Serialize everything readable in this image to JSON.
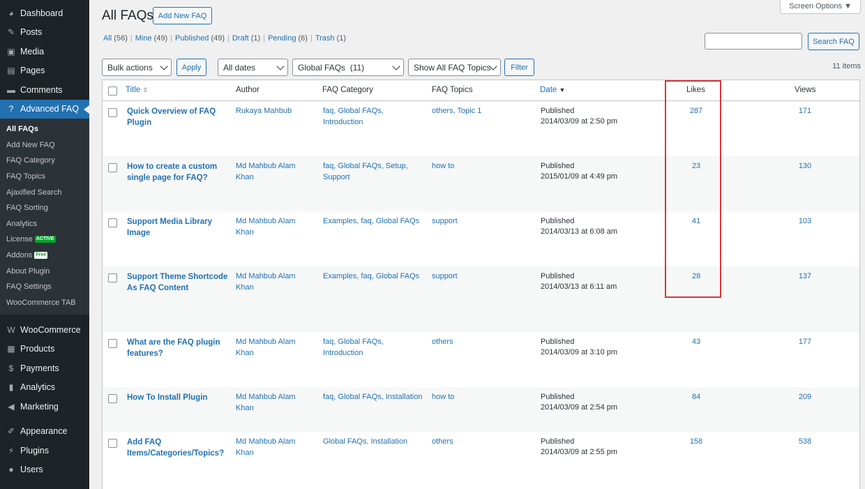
{
  "sidebar": {
    "top_items": [
      {
        "label": "Dashboard",
        "icon": "dashboard-icon",
        "glyph": "◕"
      },
      {
        "label": "Posts",
        "icon": "pushpin-icon",
        "glyph": "✎"
      },
      {
        "label": "Media",
        "icon": "media-icon",
        "glyph": "▣"
      },
      {
        "label": "Pages",
        "icon": "page-icon",
        "glyph": "▤"
      },
      {
        "label": "Comments",
        "icon": "comment-icon",
        "glyph": "▬"
      },
      {
        "label": "Advanced FAQ",
        "icon": "question-icon",
        "glyph": "?"
      }
    ],
    "submenu": [
      {
        "label": "All FAQs",
        "current": true
      },
      {
        "label": "Add New FAQ"
      },
      {
        "label": "FAQ Category"
      },
      {
        "label": "FAQ Topics"
      },
      {
        "label": "Ajaxified Search"
      },
      {
        "label": "FAQ Sorting"
      },
      {
        "label": "Analytics"
      },
      {
        "label": "License",
        "badge": "ACTIVE"
      },
      {
        "label": "Addons",
        "badge": "Free"
      },
      {
        "label": "About Plugin"
      },
      {
        "label": "FAQ Settings"
      },
      {
        "label": "WooCommerce TAB"
      }
    ],
    "bottom_items": [
      {
        "label": "WooCommerce",
        "icon": "woocommerce-icon",
        "glyph": "W"
      },
      {
        "label": "Products",
        "icon": "box-icon",
        "glyph": "▦"
      },
      {
        "label": "Payments",
        "icon": "dollar-icon",
        "glyph": "$"
      },
      {
        "label": "Analytics",
        "icon": "bar-chart-icon",
        "glyph": "▮"
      },
      {
        "label": "Marketing",
        "icon": "megaphone-icon",
        "glyph": "◀"
      }
    ],
    "bottom_items2": [
      {
        "label": "Appearance",
        "icon": "brush-icon",
        "glyph": "✐"
      },
      {
        "label": "Plugins",
        "icon": "plug-icon",
        "glyph": "⚡"
      },
      {
        "label": "Users",
        "icon": "user-icon",
        "glyph": "●"
      }
    ]
  },
  "header": {
    "title": "All FAQs",
    "add_new_label": "Add New FAQ",
    "screen_options": "Screen Options ▼"
  },
  "views": [
    {
      "label": "All",
      "count": "(56)"
    },
    {
      "label": "Mine",
      "count": "(49)"
    },
    {
      "label": "Published",
      "count": "(49)"
    },
    {
      "label": "Draft",
      "count": "(1)"
    },
    {
      "label": "Pending",
      "count": "(6)"
    },
    {
      "label": "Trash",
      "count": "(1)"
    }
  ],
  "search": {
    "button_label": "Search FAQ",
    "value": ""
  },
  "filters": {
    "bulk_actions": "Bulk actions",
    "apply_label": "Apply",
    "dates": "All dates",
    "faq_group": "Global FAQs  (11)",
    "topics": "Show All FAQ Topics",
    "filter_label": "Filter",
    "items_count": "11 items"
  },
  "columns": {
    "title": "Title",
    "author": "Author",
    "category": "FAQ Category",
    "topics": "FAQ Topics",
    "date": "Date",
    "likes": "Likes",
    "views": "Views"
  },
  "rows": [
    {
      "title": "Quick Overview of FAQ Plugin",
      "author": "Rukaya Mahbub",
      "category": "faq, Global FAQs, Introduction",
      "topics": "others, Topic 1",
      "status": "Published",
      "date": "2014/03/09 at 2:50 pm",
      "likes": "287",
      "views": "171"
    },
    {
      "title": "How to create a custom single page for FAQ?",
      "author": "Md Mahbub Alam Khan",
      "category": "faq, Global FAQs, Setup, Support",
      "topics": "how to",
      "status": "Published",
      "date": "2015/01/09 at 4:49 pm",
      "likes": "23",
      "views": "130"
    },
    {
      "title": "Support Media Library Image",
      "author": "Md Mahbub Alam Khan",
      "category": "Examples, faq, Global FAQs",
      "topics": "support",
      "status": "Published",
      "date": "2014/03/13 at 6:08 am",
      "likes": "41",
      "views": "103"
    },
    {
      "title": "Support Theme Shortcode As FAQ Content",
      "author": "Md Mahbub Alam Khan",
      "category": "Examples, faq, Global FAQs",
      "topics": "support",
      "status": "Published",
      "date": "2014/03/13 at 6:11 am",
      "likes": "28",
      "views": "137"
    },
    {
      "title": "What are the FAQ plugin features?",
      "author": "Md Mahbub Alam Khan",
      "category": "faq, Global FAQs, Introduction",
      "topics": "others",
      "status": "Published",
      "date": "2014/03/09 at 3:10 pm",
      "likes": "43",
      "views": "177"
    },
    {
      "title": "How To Install Plugin",
      "author": "Md Mahbub Alam Khan",
      "category": "faq, Global FAQs, Installation",
      "topics": "how to",
      "status": "Published",
      "date": "2014/03/09 at 2:54 pm",
      "likes": "84",
      "views": "209"
    },
    {
      "title": "Add FAQ Items/Categories/Topics?",
      "author": "Md Mahbub Alam Khan",
      "category": "Global FAQs, Installation",
      "topics": "others",
      "status": "Published",
      "date": "2014/03/09 at 2:55 pm",
      "likes": "158",
      "views": "538"
    }
  ],
  "colors": {
    "accent": "#2271b1",
    "sidebar_bg": "#1d2327",
    "highlight": "#d63638"
  }
}
